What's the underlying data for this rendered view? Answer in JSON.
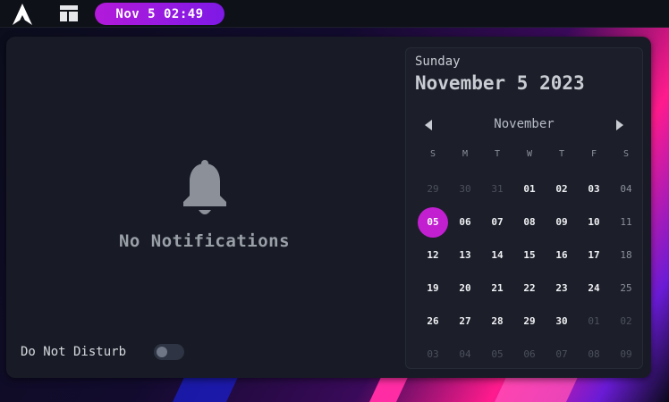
{
  "topbar": {
    "clock": "Nov 5 02:49"
  },
  "notifications": {
    "empty_label": "No Notifications",
    "dnd_label": "Do Not Disturb"
  },
  "calendar": {
    "day_name": "Sunday",
    "full_date": "November 5 2023",
    "month": "November",
    "weekdays": [
      "S",
      "M",
      "T",
      "W",
      "T",
      "F",
      "S"
    ],
    "weeks": [
      [
        "29",
        "30",
        "31",
        "01",
        "02",
        "03",
        "04"
      ],
      [
        "05",
        "06",
        "07",
        "08",
        "09",
        "10",
        "11"
      ],
      [
        "12",
        "13",
        "14",
        "15",
        "16",
        "17",
        "18"
      ],
      [
        "19",
        "20",
        "21",
        "22",
        "23",
        "24",
        "25"
      ],
      [
        "26",
        "27",
        "28",
        "29",
        "30",
        "01",
        "02"
      ],
      [
        "03",
        "04",
        "05",
        "06",
        "07",
        "08",
        "09"
      ]
    ],
    "today": "05"
  },
  "colors": {
    "accent": "#c21fd1",
    "panel_bg": "#181b25"
  }
}
